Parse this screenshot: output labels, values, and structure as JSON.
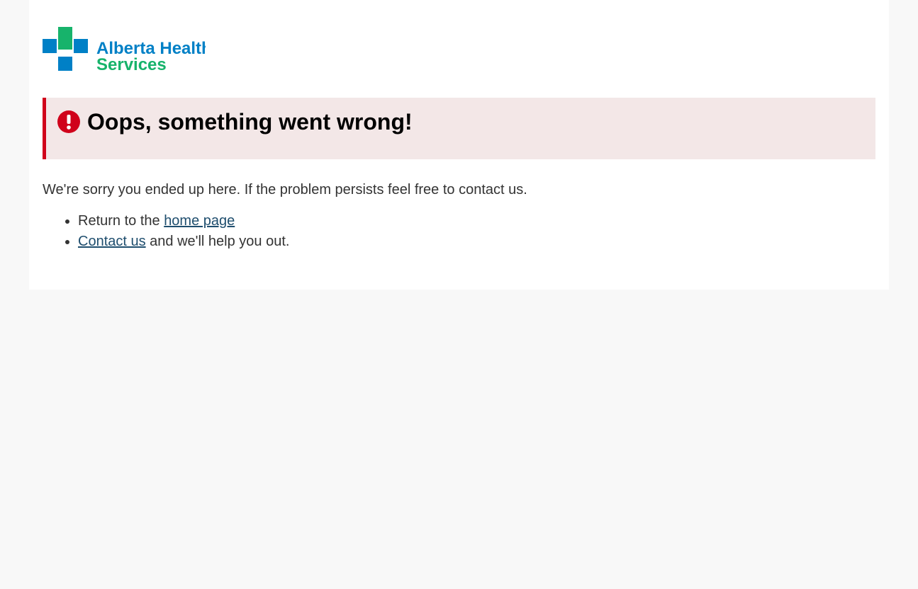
{
  "logo": {
    "line1": "Alberta Health",
    "line2": "Services",
    "colors": {
      "blue": "#0080c6",
      "green": "#17b36b"
    }
  },
  "alert": {
    "icon": "exclamation-circle-icon",
    "title": "Oops, something went wrong!",
    "color": "#d0021b"
  },
  "intro": "We're sorry you ended up here. If the problem persists feel free to contact us.",
  "links": {
    "item1_prefix": "Return to the ",
    "item1_link": "home page",
    "item2_link": "Contact us",
    "item2_suffix": " and we'll help you out."
  }
}
